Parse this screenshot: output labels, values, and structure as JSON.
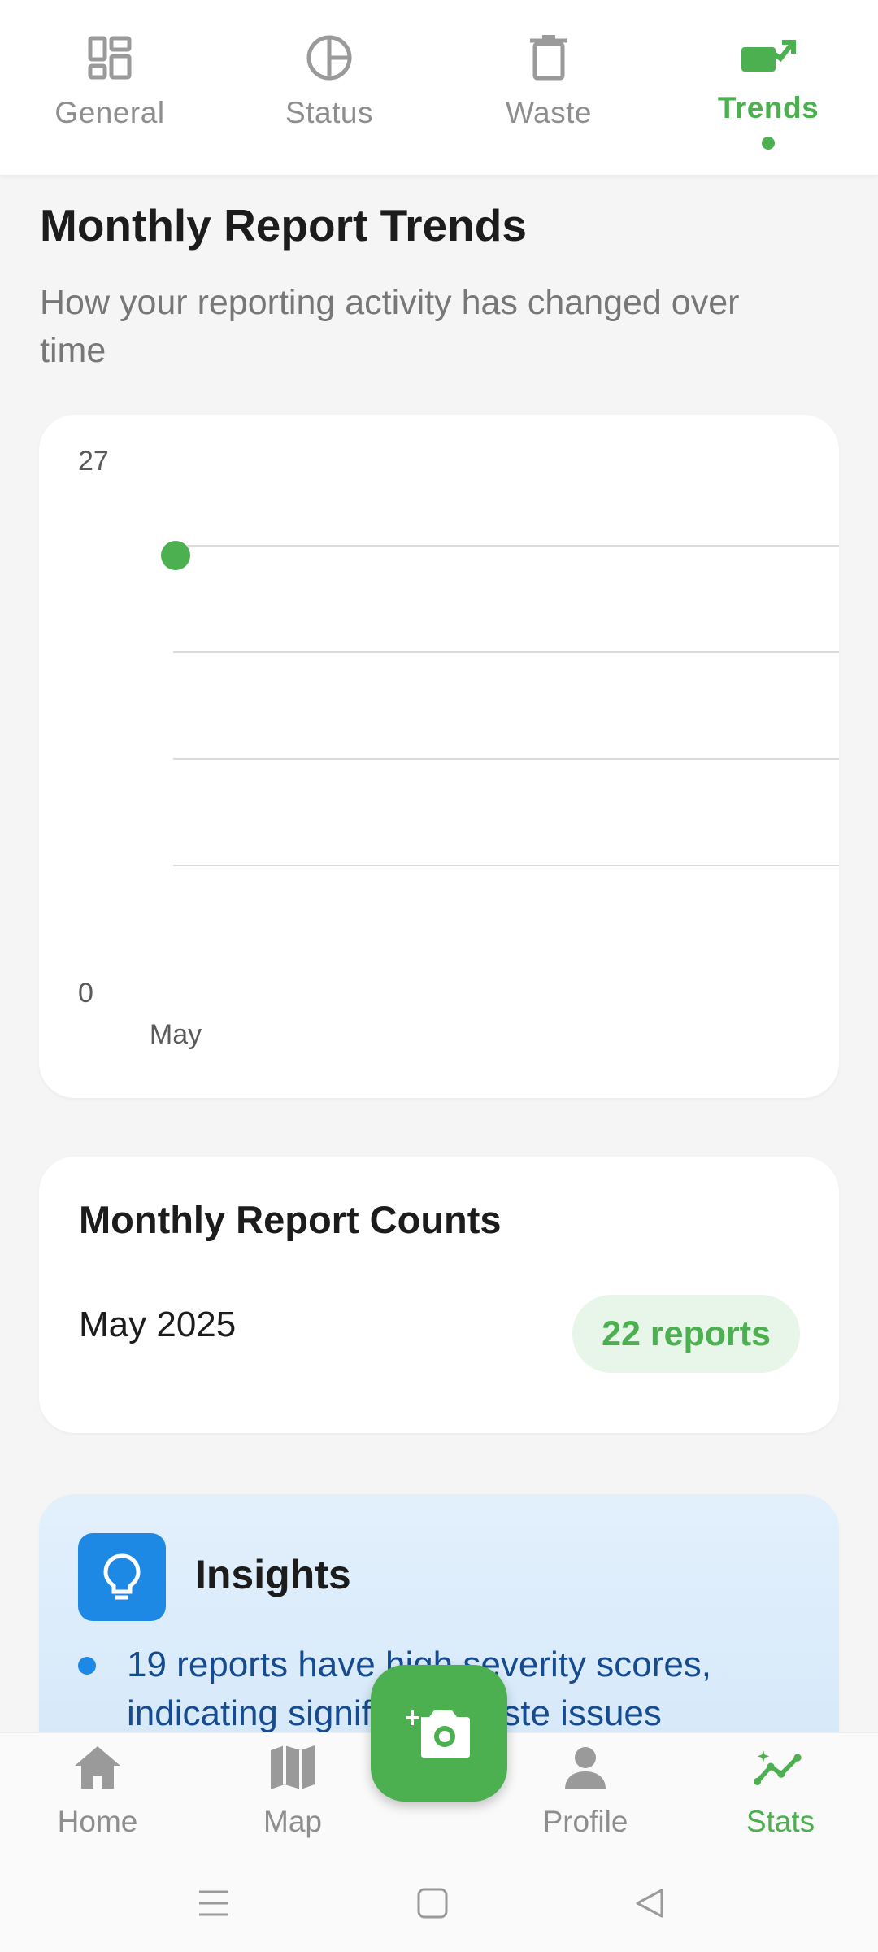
{
  "top_tabs": [
    {
      "label": "General",
      "icon": "dashboard-icon",
      "active": false
    },
    {
      "label": "Status",
      "icon": "pie-chart-icon",
      "active": false
    },
    {
      "label": "Waste",
      "icon": "trash-icon",
      "active": false
    },
    {
      "label": "Trends",
      "icon": "trending-up-icon",
      "active": true
    }
  ],
  "page": {
    "title": "Monthly Report Trends",
    "subtitle": "How your reporting activity has changed over time"
  },
  "chart_data": {
    "type": "line",
    "categories": [
      "May"
    ],
    "series": [
      {
        "values": [
          22
        ]
      }
    ],
    "ylim": [
      0,
      27
    ],
    "y_tick_labels": [
      "27",
      "0"
    ],
    "grid": true,
    "color": "#4caf50"
  },
  "counts": {
    "title": "Monthly Report Counts",
    "rows": [
      {
        "month": "May 2025",
        "count_label": "22 reports"
      }
    ]
  },
  "insights": {
    "title": "Insights",
    "icon": "lightbulb-icon",
    "items": [
      "19 reports have high severity scores, indicating significant waste issues"
    ]
  },
  "bottom_nav": [
    {
      "label": "Home",
      "icon": "home-icon",
      "active": false
    },
    {
      "label": "Map",
      "icon": "map-icon",
      "active": false
    },
    {
      "label": "Profile",
      "icon": "person-icon",
      "active": false
    },
    {
      "label": "Stats",
      "icon": "insights-icon",
      "active": true
    }
  ],
  "fab": {
    "icon": "add-photo-icon"
  },
  "colors": {
    "accent": "#4caf50",
    "accent_light": "#e8f5e9",
    "info_blue": "#1e88e5",
    "inactive": "#8e8e8e"
  }
}
